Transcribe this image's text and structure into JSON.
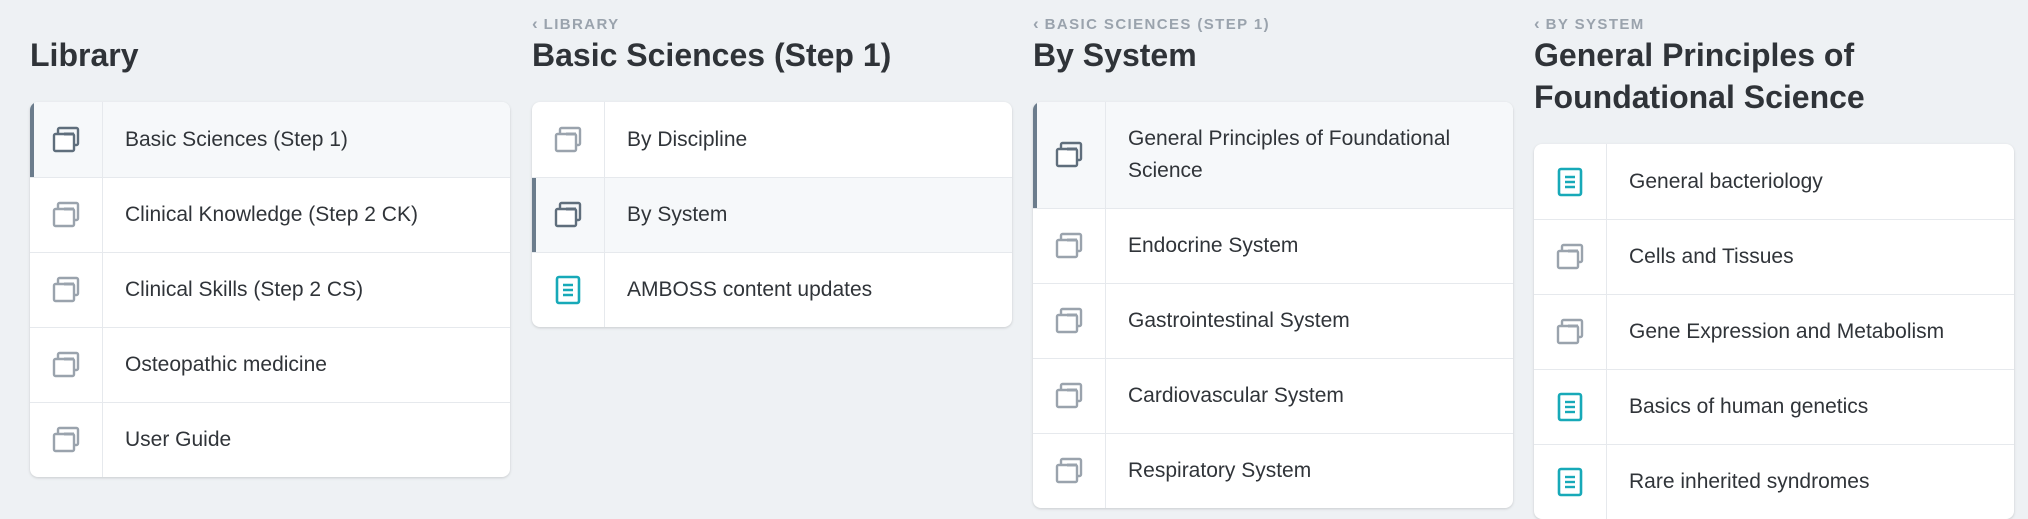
{
  "columns": [
    {
      "breadcrumb": "",
      "title": "Library",
      "items": [
        {
          "label": "Basic Sciences (Step 1)",
          "icon": "folder-icon",
          "active": true
        },
        {
          "label": "Clinical Knowledge (Step 2 CK)",
          "icon": "folder-icon",
          "active": false
        },
        {
          "label": "Clinical Skills (Step 2 CS)",
          "icon": "folder-icon",
          "active": false
        },
        {
          "label": "Osteopathic medicine",
          "icon": "folder-icon",
          "active": false
        },
        {
          "label": "User Guide",
          "icon": "folder-icon",
          "active": false
        }
      ]
    },
    {
      "breadcrumb": "LIBRARY",
      "title": "Basic Sciences (Step 1)",
      "items": [
        {
          "label": "By Discipline",
          "icon": "folder-icon",
          "active": false
        },
        {
          "label": "By System",
          "icon": "folder-icon",
          "active": true
        },
        {
          "label": "AMBOSS content updates",
          "icon": "article-icon",
          "active": false
        }
      ]
    },
    {
      "breadcrumb": "BASIC SCIENCES (STEP 1)",
      "title": "By System",
      "items": [
        {
          "label": "General Principles of Foundational Science",
          "icon": "folder-icon",
          "active": true
        },
        {
          "label": "Endocrine System",
          "icon": "folder-icon",
          "active": false
        },
        {
          "label": "Gastrointestinal System",
          "icon": "folder-icon",
          "active": false
        },
        {
          "label": "Cardiovascular System",
          "icon": "folder-icon",
          "active": false
        },
        {
          "label": "Respiratory System",
          "icon": "folder-icon",
          "active": false
        }
      ]
    },
    {
      "breadcrumb": "BY SYSTEM",
      "title": "General Principles of Foundational Science",
      "items": [
        {
          "label": "General bacteriology",
          "icon": "article-icon",
          "active": false
        },
        {
          "label": "Cells and Tissues",
          "icon": "folder-icon",
          "active": false
        },
        {
          "label": "Gene Expression and Metabolism",
          "icon": "folder-icon",
          "active": false
        },
        {
          "label": "Basics of human genetics",
          "icon": "article-icon",
          "active": false
        },
        {
          "label": "Rare inherited syndromes",
          "icon": "article-icon",
          "active": false
        }
      ]
    }
  ],
  "colors": {
    "background": "#eef1f4",
    "folder_icon": "#9aa3ad",
    "folder_icon_active": "#5f6e7c",
    "article_icon": "#17a9b8",
    "active_bar": "#6b7c8c",
    "breadcrumb": "#9aa3ad"
  }
}
